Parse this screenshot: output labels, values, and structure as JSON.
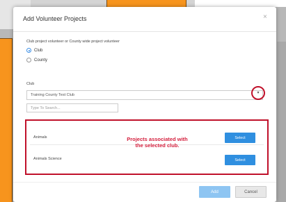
{
  "modal": {
    "title": "Add Volunteer Projects",
    "close_glyph": "×"
  },
  "volunteer_type": {
    "question": "Club project volunteer or County wide project volunteer",
    "options": [
      {
        "label": "Club",
        "selected": true
      },
      {
        "label": "County",
        "selected": false
      }
    ]
  },
  "club": {
    "label": "Club",
    "selected_value": "Training County Test Club",
    "dropdown_glyph": "▾"
  },
  "search": {
    "placeholder": "Type To Search..."
  },
  "projects": [
    {
      "name": "Animals",
      "button_label": "Select"
    },
    {
      "name": "Animals Science",
      "button_label": "Select"
    }
  ],
  "annotation": {
    "line1": "Projects associated with",
    "line2": "the selected club.",
    "color": "#d41f3d"
  },
  "footer": {
    "add_label": "Add",
    "cancel_label": "Cancel"
  },
  "colors": {
    "accent": "#2f8fe0",
    "highlight": "#c0102a",
    "background_orange": "#f7941d"
  }
}
